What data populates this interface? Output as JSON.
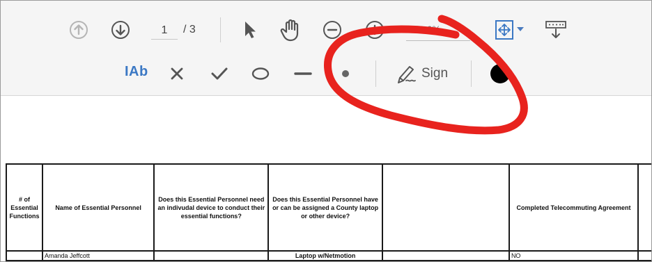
{
  "toolbar": {
    "page_current": "1",
    "page_total": "/ 3",
    "zoom_value": "93.6%",
    "prev_page_icon": "arrow-up-circle-icon",
    "next_page_icon": "arrow-down-circle-icon",
    "select_icon": "cursor-arrow-icon",
    "hand_icon": "hand-icon",
    "zoom_out_icon": "minus-circle-icon",
    "zoom_in_icon": "plus-circle-icon",
    "fit_icon": "fit-page-icon",
    "download_icon": "keyboard-download-icon"
  },
  "fill_sign": {
    "text_tool": "IAb",
    "sign_label": "Sign",
    "color_swatch": "#000000",
    "icons": [
      "cross-icon",
      "check-icon",
      "ellipse-icon",
      "line-icon",
      "dot-icon",
      "pen-sign-icon"
    ]
  },
  "annotation": {
    "stroke_color": "#e8231e"
  },
  "table": {
    "headers": [
      "# of Essential Functions",
      "Name of Essential Personnel",
      "Does this Essential Personnel need an indivudal device to conduct their essential functions?",
      "Does this Essential Personnel have or can be assigned a County laptop or other device?",
      "",
      "Completed Telecommuting Agreement",
      ""
    ],
    "rows": [
      [
        "",
        "Amanda Jeffcott",
        "",
        "Laptop w/Netmotion",
        "",
        "NO",
        ""
      ]
    ]
  }
}
